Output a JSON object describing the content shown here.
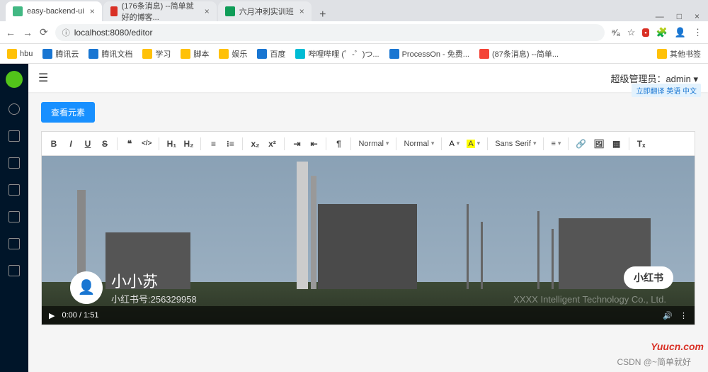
{
  "browser": {
    "tabs": [
      {
        "title": "easy-backend-ui",
        "favicon": "#42b883"
      },
      {
        "title": "(176条消息) --简单就好的博客...",
        "favicon": "#d93025"
      },
      {
        "title": "六月冲刺实训班",
        "favicon": "#0f9d58"
      }
    ],
    "url": "localhost:8080/editor",
    "window_controls": [
      "—",
      "□",
      "×"
    ]
  },
  "bookmarks": [
    {
      "label": "hbu"
    },
    {
      "label": "腾讯云"
    },
    {
      "label": "腾讯文档"
    },
    {
      "label": "学习"
    },
    {
      "label": "脚本"
    },
    {
      "label": "娱乐"
    },
    {
      "label": "百度"
    },
    {
      "label": "哔哩哔哩 (゜-゜)つ..."
    },
    {
      "label": "ProcessOn - 免费..."
    },
    {
      "label": "(87条消息) --简单..."
    },
    {
      "label": "其他书签"
    }
  ],
  "app": {
    "admin_label": "超级管理员：admin",
    "translate_hint": "立即翻译 英语 中文",
    "button_view": "查看元素",
    "toolbar": {
      "bold": "B",
      "italic": "I",
      "underline": "U",
      "strike": "S",
      "quote": "❝",
      "code": "</>",
      "h1": "H₁",
      "h2": "H₂",
      "ol": "≡",
      "ul": "⁝≡",
      "sub": "x₂",
      "sup": "x²",
      "indent_in": "⇥",
      "indent_out": "⇤",
      "rtl": "¶",
      "size": "Normal",
      "header": "Normal",
      "font": "Sans Serif",
      "color": "A",
      "bg": "A",
      "align": "≡",
      "link": "🔗",
      "image": "🖼",
      "video": "▦",
      "clean": "Tₓ"
    }
  },
  "video": {
    "username": "小小苏",
    "user_id": "小红书号:256329958",
    "badge": "小红书",
    "company": "XXXX Intelligent Technology Co., Ltd.",
    "time_current": "0:00",
    "time_total": "1:51",
    "play": "▶",
    "volume": "🔊",
    "more": "⋮"
  },
  "watermarks": {
    "site": "Yuucn.com",
    "author": "CSDN @~简单就好"
  }
}
